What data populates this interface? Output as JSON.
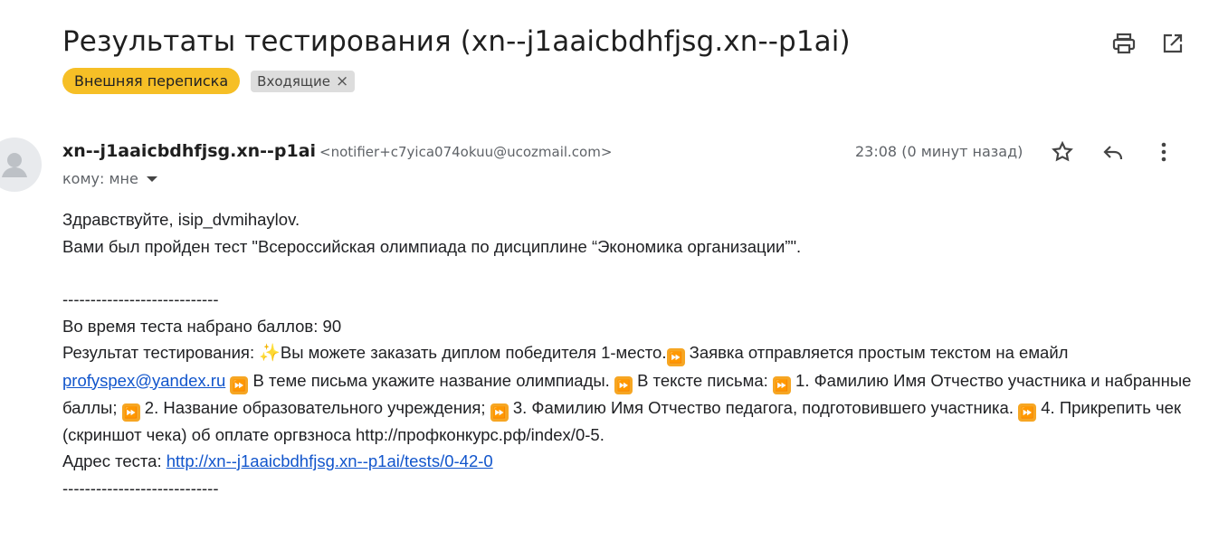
{
  "subject": "Результаты тестирования (xn--j1aaicbdhfjsg.xn--p1ai)",
  "labels": {
    "primary": "Внешняя переписка",
    "secondary": "Входящие",
    "secondary_close": "×"
  },
  "sender": {
    "name": "xn--j1aaicbdhfjsg.xn--p1ai",
    "email": "<notifier+c7yica074okuu@ucozmail.com>",
    "time": "23:08 (0 минут назад)",
    "to": "кому: мне"
  },
  "body": {
    "greeting": "Здравствуйте, isip_dvmihaylov.",
    "intro": "Вами был пройден тест \"Всероссийская олимпиада по дисциплине “Экономика организации”\".",
    "separator": "----------------------------",
    "score": "Во время теста набрано баллов: 90",
    "result_prefix": "Результат тестирования: ",
    "result_sparkle": "✨",
    "result_1": "Вы можете заказать диплом победителя 1-место.",
    "result_2": " Заявка отправляется простым текстом на емайл ",
    "email_link": "profyspex@yandex.ru",
    "result_3": " В теме письма укажите название олимпиады. ",
    "result_4": " В тексте письма: ",
    "result_5": " 1. Фамилию Имя Отчество участника и набранные баллы; ",
    "result_6": " 2. Название образовательного учреждения; ",
    "result_7": " 3. Фамилию Имя Отчество педагога, подготовившего участника. ",
    "result_8": " 4. Прикрепить чек (скриншот чека) об оплате оргвзноса http://профконкурс.рф/index/0-5.",
    "address_label": "Адрес теста: ",
    "address_link": "http://xn--j1aaicbdhfjsg.xn--p1ai/tests/0-42-0",
    "fast_forward_glyph": "⏩"
  },
  "icons": {
    "print": "print-icon",
    "open_new": "open-in-new-icon",
    "star": "star-icon",
    "reply": "reply-icon",
    "more": "more-vert-icon",
    "dropdown": "arrow-drop-down-icon",
    "avatar": "avatar-icon",
    "fast_forward": "fast-forward-emoji"
  },
  "colors": {
    "primary_label": "#f6bf26",
    "secondary_label": "#dddddd",
    "link": "#1155cc",
    "emoji": "#f6a623"
  }
}
